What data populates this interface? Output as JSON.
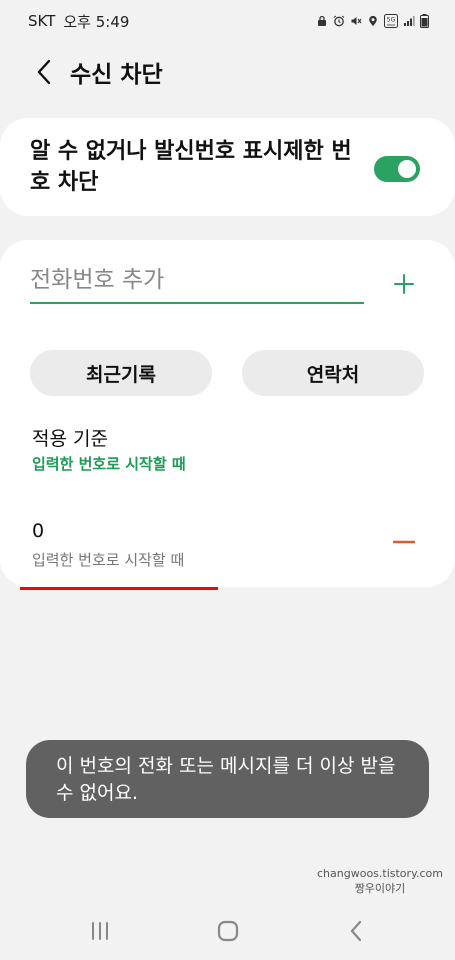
{
  "status_bar": {
    "carrier": "SKT",
    "time": "오후 5:49",
    "network": "5G",
    "icons": [
      "lock-icon",
      "alarm-icon",
      "mute-icon",
      "location-icon",
      "network-5g-icon",
      "signal-icon",
      "battery-icon"
    ]
  },
  "header": {
    "title": "수신 차단",
    "back_icon": "chevron-left-icon"
  },
  "block_unknown": {
    "label": "알 수 없거나 발신번호 표시제한 번호 차단",
    "enabled": true,
    "accent_color": "#2ba162"
  },
  "add_number": {
    "placeholder": "전화번호 추가",
    "value": "",
    "add_icon": "plus-icon"
  },
  "buttons": {
    "recent_label": "최근기록",
    "contacts_label": "연락처"
  },
  "criteria": {
    "title": "적용 기준",
    "value": "입력한 번호로 시작할 때"
  },
  "blocked_entries": [
    {
      "number": "0",
      "rule": "입력한 번호로 시작할 때"
    }
  ],
  "toast": {
    "message": "이 번호의 전화 또는 메시지를 더 이상 받을 수 없어요."
  },
  "watermark": {
    "line1": "changwoos.tistory.com",
    "line2": "짱우이야기"
  },
  "nav": {
    "recents_icon": "recents-icon",
    "home_icon": "home-icon",
    "back_icon": "nav-back-icon"
  },
  "colors": {
    "accent_green": "#2ba162",
    "remove_red": "#e05a2b",
    "annotation_red": "#e00e0e"
  }
}
